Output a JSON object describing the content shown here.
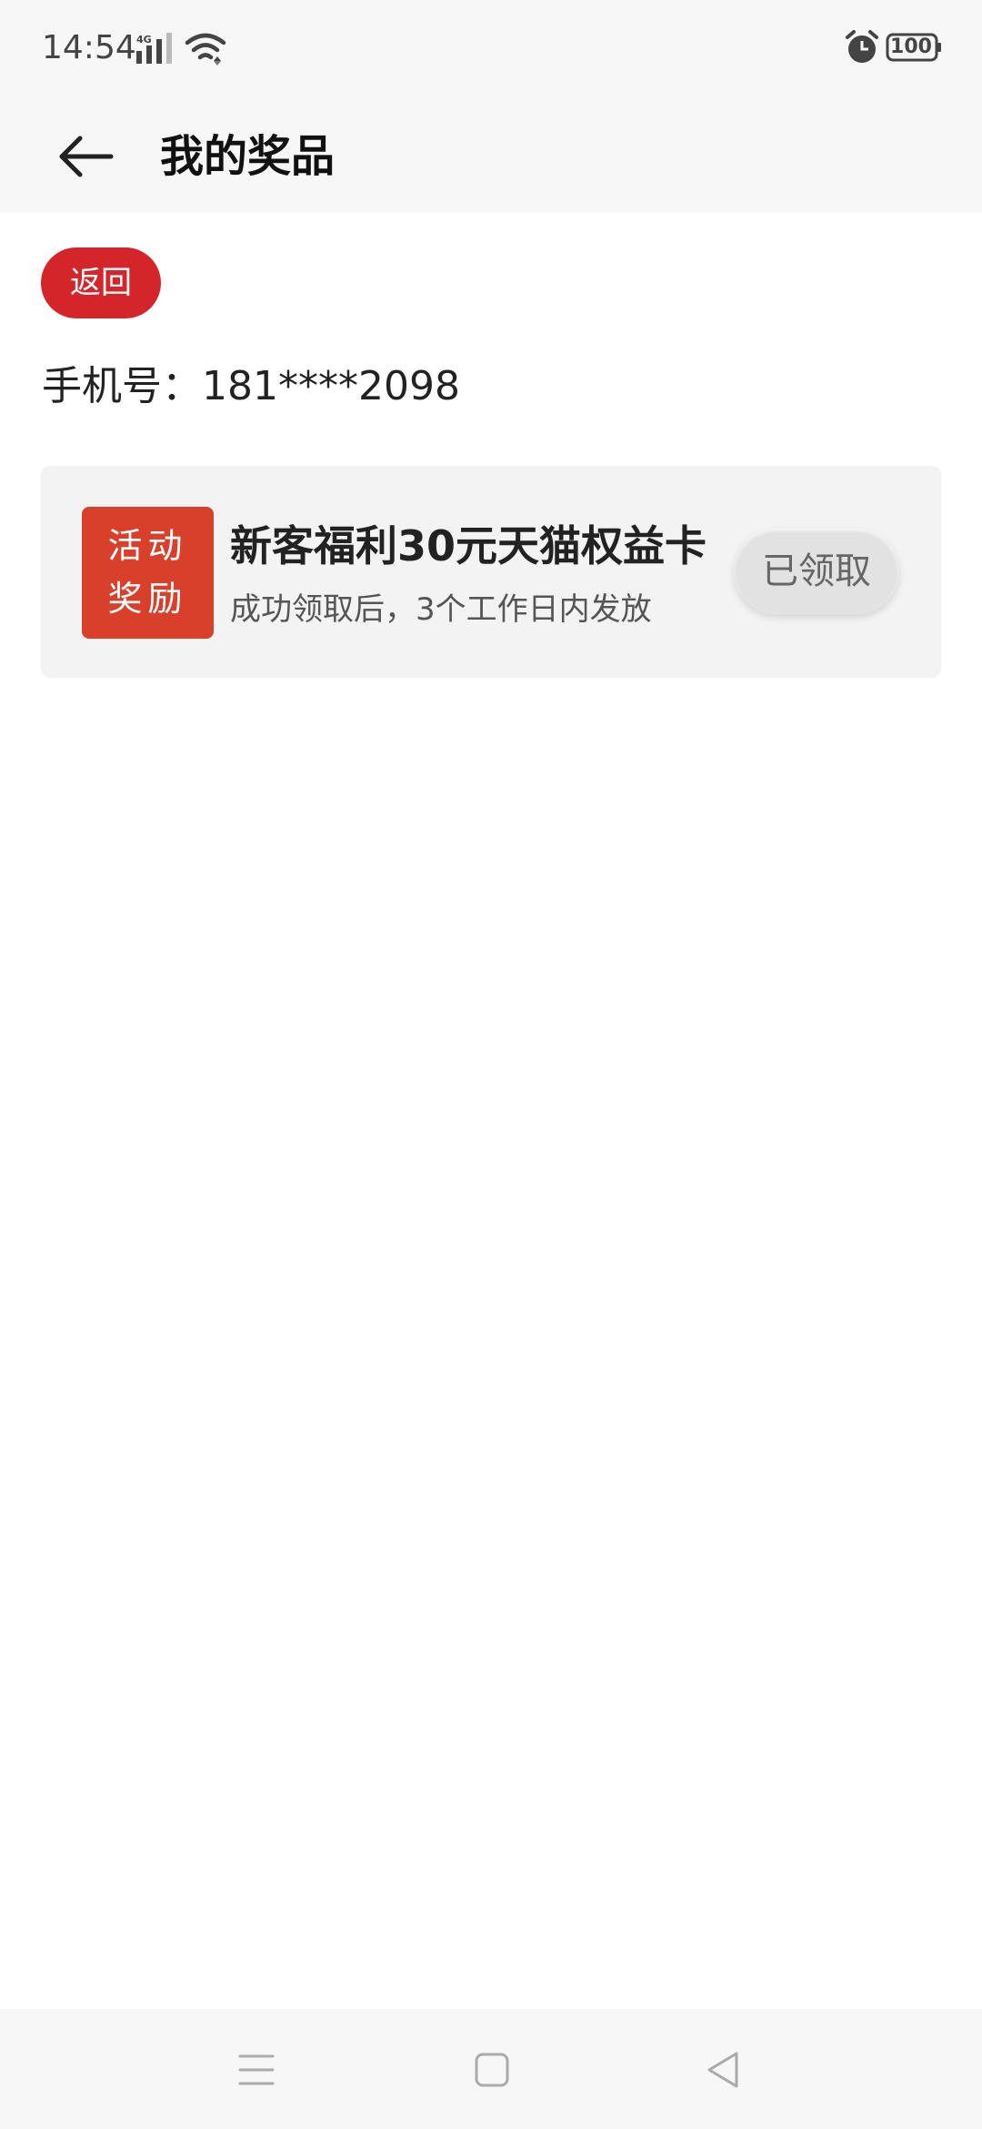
{
  "status_bar": {
    "time": "14:54",
    "network_label": "4G",
    "battery": "100",
    "icons": [
      "signal-icon",
      "wifi-icon",
      "alarm-icon",
      "battery-icon"
    ]
  },
  "header": {
    "title": "我的奖品",
    "back_icon": "back-arrow-icon"
  },
  "main": {
    "back_button_label": "返回",
    "phone_label": "手机号：",
    "phone_number": "181****2098",
    "prize": {
      "badge_line1": "活动",
      "badge_line2": "奖励",
      "title": "新客福利30元天猫权益卡",
      "subtitle": "成功领取后，3个工作日内发放",
      "status_button": "已领取"
    }
  },
  "nav_bar": {
    "items": [
      "menu-icon",
      "home-icon",
      "back-icon"
    ]
  },
  "colors": {
    "accent_red": "#d4252b",
    "badge_red": "#d8402c",
    "card_bg": "#f3f3f3",
    "bar_bg": "#f7f7f7"
  }
}
